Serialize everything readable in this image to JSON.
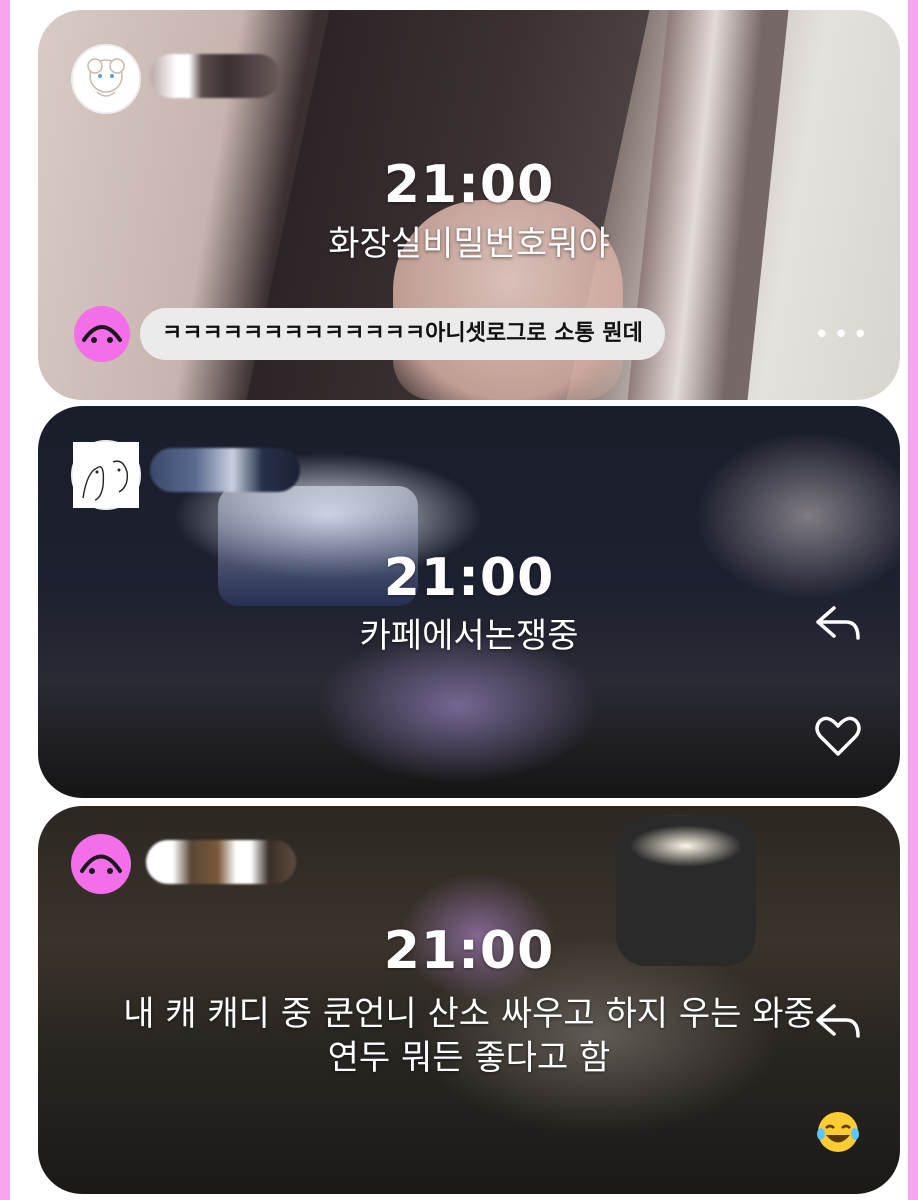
{
  "posts": [
    {
      "time": "21:00",
      "caption": "화장실비밀번호뭐야",
      "comment": "ㅋㅋㅋㅋㅋㅋㅋㅋㅋㅋㅋㅋㅋ아니셋로그로 소통 뭔데",
      "icons": [
        "avatar-sheep",
        "smiley-avatar",
        "more-dots"
      ]
    },
    {
      "time": "21:00",
      "caption": "카페에서논쟁중",
      "icons": [
        "avatar-sketch",
        "reply-icon",
        "heart-icon"
      ]
    },
    {
      "time": "21:00",
      "caption_line1": "내 캐 캐디 중 쿤언니 산소 싸우고 하지 우는 와중",
      "caption_line2": "연두 뭐든 좋다고 함",
      "icons": [
        "smiley-avatar",
        "reply-icon",
        "laughing-emoji"
      ]
    }
  ],
  "colors": {
    "accent": "#f46ee9",
    "frame": "#f6a6ef",
    "text": "#ffffff"
  }
}
